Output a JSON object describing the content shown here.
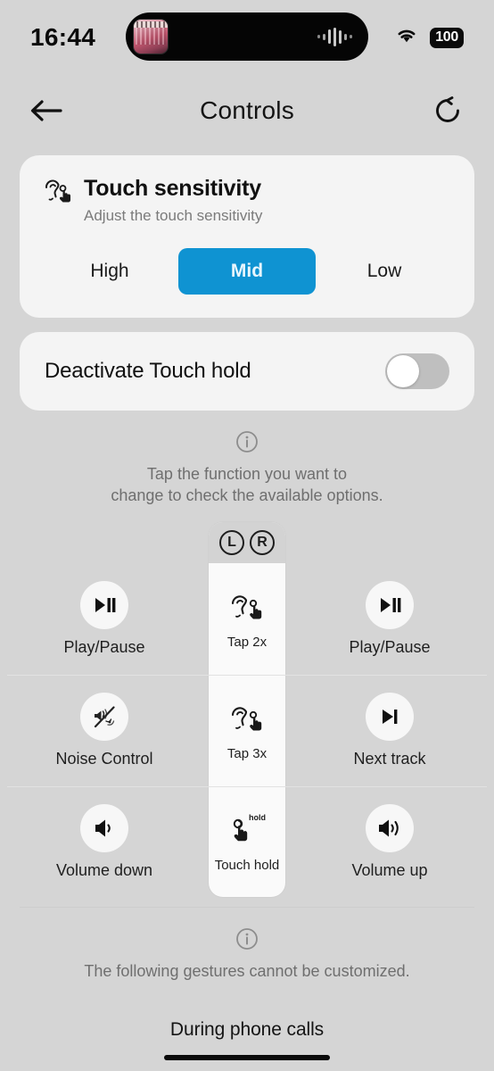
{
  "status_bar": {
    "time": "16:44",
    "battery": "100",
    "wifi_icon": "wifi-icon",
    "island_icon": "album-art-thumbnail",
    "island_waveform": "audio-waveform-icon"
  },
  "nav": {
    "back_icon": "back-arrow-icon",
    "title": "Controls",
    "reset_icon": "reset-refresh-icon"
  },
  "touch_sensitivity": {
    "icon": "ear-tap-icon",
    "title": "Touch sensitivity",
    "subtitle": "Adjust the touch sensitivity",
    "options": [
      {
        "label": "High",
        "selected": false
      },
      {
        "label": "Mid",
        "selected": true
      },
      {
        "label": "Low",
        "selected": false
      }
    ],
    "accent_color": "#0f93d2"
  },
  "touch_hold_toggle": {
    "label": "Deactivate Touch hold",
    "state": "off"
  },
  "info_top": {
    "icon": "info-circle-icon",
    "line1": "Tap the function you want to",
    "line2": "change to check the available options."
  },
  "gesture_grid": {
    "header": {
      "left": "L",
      "right": "R"
    },
    "rows": [
      {
        "left": {
          "icon": "play-pause-icon",
          "label": "Play/Pause"
        },
        "center": {
          "icon": "ear-tap-icon",
          "label": "Tap 2x"
        },
        "right": {
          "icon": "play-pause-icon",
          "label": "Play/Pause"
        }
      },
      {
        "left": {
          "icon": "noise-control-icon",
          "label": "Noise Control"
        },
        "center": {
          "icon": "ear-tap-icon",
          "label": "Tap 3x"
        },
        "right": {
          "icon": "next-track-icon",
          "label": "Next track"
        }
      },
      {
        "left": {
          "icon": "volume-down-icon",
          "label": "Volume down"
        },
        "center": {
          "icon": "hand-hold-icon",
          "label": "Touch hold",
          "badge": "hold"
        },
        "right": {
          "icon": "volume-up-icon",
          "label": "Volume up"
        }
      }
    ]
  },
  "info_bottom": {
    "icon": "info-circle-icon",
    "text": "The following gestures cannot be customized."
  },
  "section_phone_calls": {
    "title": "During phone calls"
  }
}
